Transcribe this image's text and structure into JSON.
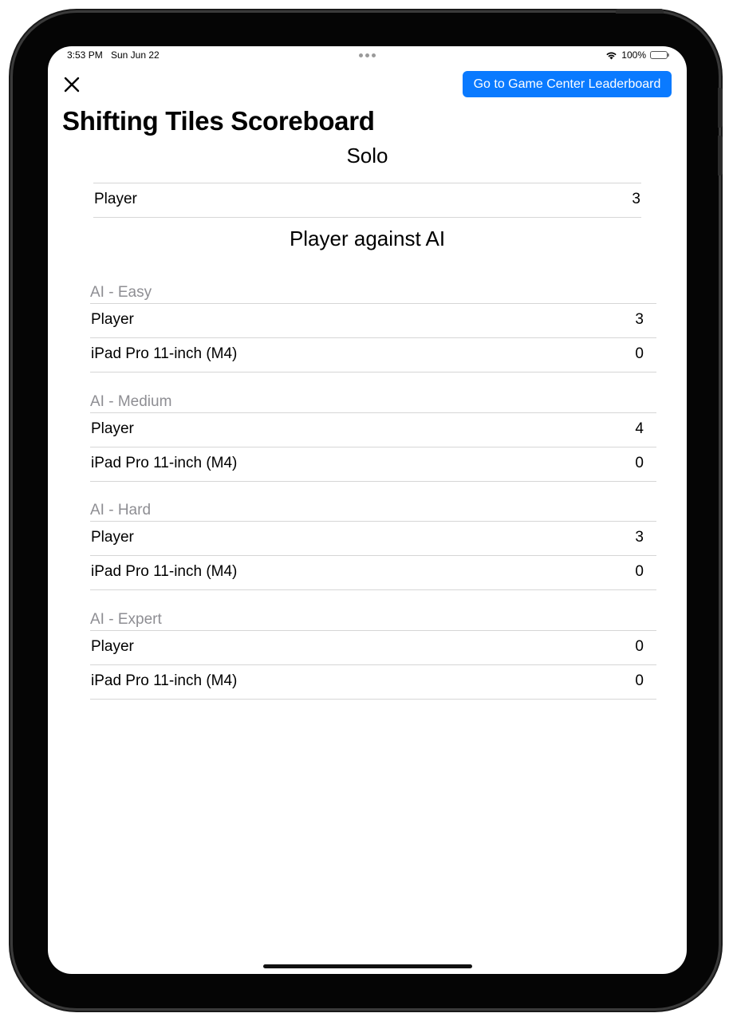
{
  "status_bar": {
    "time": "3:53 PM",
    "date": "Sun Jun 22",
    "battery": "100%"
  },
  "toolbar": {
    "close_icon": "close-icon",
    "leaderboard_button": "Go to Game Center Leaderboard"
  },
  "page_title": "Shifting Tiles Scoreboard",
  "solo": {
    "heading": "Solo",
    "rows": [
      {
        "name": "Player",
        "score": "3"
      }
    ]
  },
  "vs_ai": {
    "heading": "Player against AI",
    "groups": [
      {
        "label": "AI - Easy",
        "rows": [
          {
            "name": "Player",
            "score": "3"
          },
          {
            "name": "iPad Pro 11-inch (M4)",
            "score": "0"
          }
        ]
      },
      {
        "label": "AI - Medium",
        "rows": [
          {
            "name": "Player",
            "score": "4"
          },
          {
            "name": "iPad Pro 11-inch (M4)",
            "score": "0"
          }
        ]
      },
      {
        "label": "AI - Hard",
        "rows": [
          {
            "name": "Player",
            "score": "3"
          },
          {
            "name": "iPad Pro 11-inch (M4)",
            "score": "0"
          }
        ]
      },
      {
        "label": "AI - Expert",
        "rows": [
          {
            "name": "Player",
            "score": "0"
          },
          {
            "name": "iPad Pro 11-inch (M4)",
            "score": "0"
          }
        ]
      }
    ]
  },
  "colors": {
    "accent": "#0a7aff",
    "section_label": "#8e8e93",
    "divider": "#d6d6d6"
  }
}
